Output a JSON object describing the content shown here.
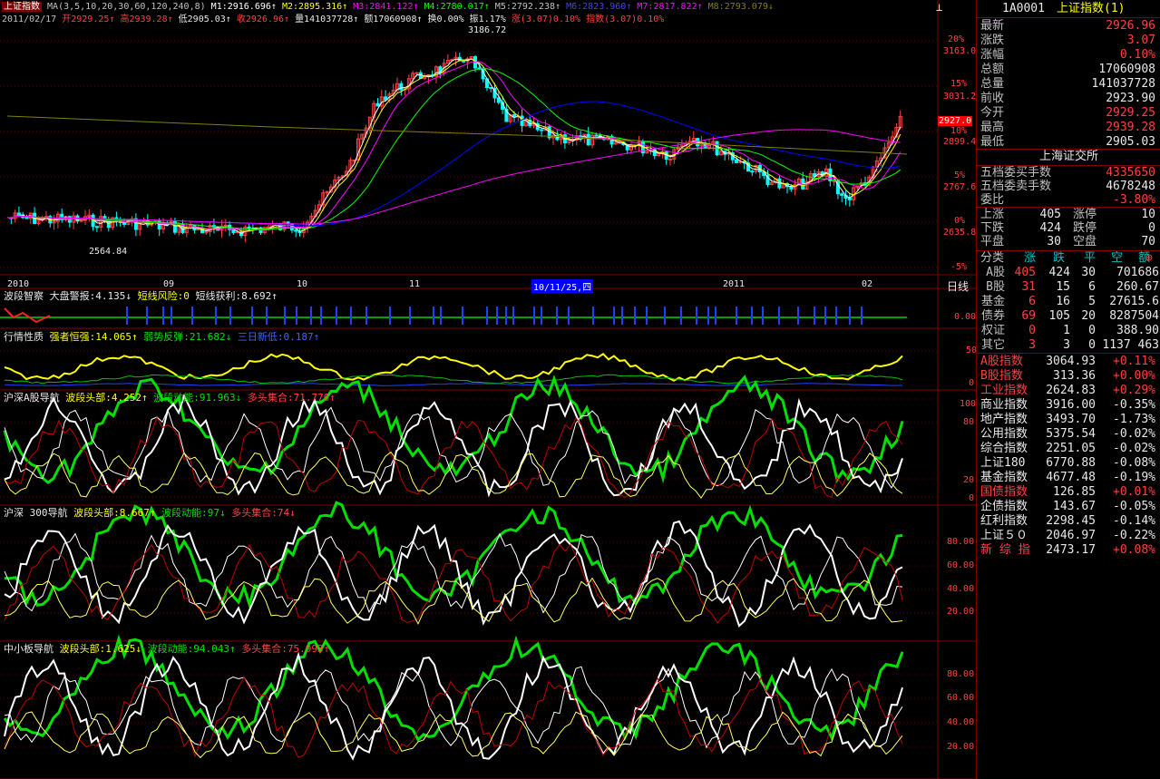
{
  "colors": {
    "up": "#ff4040",
    "down": "#00e000",
    "ma1": "#ffffff",
    "ma2": "#ffff00",
    "ma3": "#ff00ff",
    "ma4": "#00ff00",
    "ma5": "#c0c0c0",
    "ma6": "#0000ff",
    "ma7": "#ff00ff",
    "ma8": "#808000",
    "frame": "#800000"
  },
  "header": {
    "title": "上证指数",
    "ma_label": "MA(3,5,10,20,30,60,120,240,8)",
    "ma_values": [
      "M1:2916.696↑",
      "M2:2895.316↑",
      "M3:2841.122↑",
      "M4:2780.017↑",
      "M5:2792.238↑",
      "M6:2823.960↑",
      "M7:2817.822↑",
      "M8:2793.079↓"
    ],
    "line2": [
      "2011/02/17",
      "开2929.25↑",
      "高2939.28↑",
      "低2905.03↑",
      "收2926.96↑",
      "量141037728↑",
      "额17060908↑",
      "换0.00%",
      "振1.17%",
      "涨(3.07)0.10%",
      "指数(3.07)0.10%"
    ]
  },
  "price_axis": {
    "labels": [
      "3163.0",
      "3031.2",
      "2899.4",
      "2767.6",
      "2635.8"
    ],
    "pct": [
      "20%",
      "15%",
      "10%",
      "5%",
      "0%",
      "-5%"
    ],
    "current_tag": "2927.0",
    "high_label": "3186.72",
    "low_label": "2564.84"
  },
  "time_axis": {
    "labels": [
      "2010",
      "09",
      "10",
      "11",
      "10/11/25,四",
      "2011",
      "02"
    ],
    "period": "日线"
  },
  "indicators": [
    {
      "title": "波段智察",
      "items": [
        "大盘警报:4.135↓",
        "短线风险:0",
        "短线获利:8.692↑"
      ],
      "axis": [
        "0.00"
      ]
    },
    {
      "title": "行情性质",
      "items": [
        "强者恒强:14.065↑",
        "弱势反弹:21.682↓",
        "三日新低:0.187↑"
      ],
      "axis": [
        "50",
        "0"
      ]
    },
    {
      "title": "沪深A股导航",
      "items": [
        "波段头部:4.252↑",
        "波段动能:91.963↓",
        "多头集合:71.776↑"
      ],
      "axis": [
        "100",
        "80",
        "20",
        "0"
      ]
    },
    {
      "title": "沪深 300导航",
      "items": [
        "波段头部:8.667↑",
        "波段动能:97↓",
        "多头集合:74↓"
      ],
      "axis": [
        "80.00",
        "60.00",
        "40.00",
        "20.00"
      ]
    },
    {
      "title": "中小板导航",
      "items": [
        "波段头部:1.625↓",
        "波段动能:94.043↑",
        "多头集合:75.993↑"
      ],
      "axis": [
        "80.00",
        "60.00",
        "40.00",
        "20.00"
      ]
    }
  ],
  "panel": {
    "code": "1A0001",
    "name": "上证指数(1)",
    "quote": [
      {
        "label": "最新",
        "value": "2926.96",
        "c": "red"
      },
      {
        "label": "涨跌",
        "value": "3.07",
        "c": "red"
      },
      {
        "label": "涨幅",
        "value": "0.10%",
        "c": "red"
      },
      {
        "label": "总额",
        "value": "17060908",
        "c": "white"
      },
      {
        "label": "总量",
        "value": "141037728",
        "c": "white"
      },
      {
        "label": "前收",
        "value": "2923.90",
        "c": "white"
      },
      {
        "label": "今开",
        "value": "2929.25",
        "c": "red"
      },
      {
        "label": "最高",
        "value": "2939.28",
        "c": "red"
      },
      {
        "label": "最低",
        "value": "2905.03",
        "c": "white"
      }
    ],
    "exchange": "上海证交所",
    "orders": [
      {
        "label": "五档委买手数",
        "value": "4335650",
        "c": "red"
      },
      {
        "label": "五档委卖手数",
        "value": "4678248",
        "c": "white"
      },
      {
        "label": "委比",
        "value": "-3.80%",
        "c": "red"
      }
    ],
    "breadth": [
      {
        "l1": "上涨",
        "v1": "405",
        "l2": "涨停",
        "v2": "10"
      },
      {
        "l1": "下跌",
        "v1": "424",
        "l2": "跌停",
        "v2": "0"
      },
      {
        "l1": "平盘",
        "v1": "30",
        "l2": "空盘",
        "v2": "70"
      }
    ],
    "cls_header": [
      "分类",
      "涨",
      "跌",
      "平",
      "空",
      "额"
    ],
    "cls_rows": [
      {
        "n": "A股",
        "a": "405",
        "b": "424",
        "c": "30",
        "d": "701686"
      },
      {
        "n": "B股",
        "a": "31",
        "b": "15",
        "c": "6",
        "d": "260.67"
      },
      {
        "n": "基金",
        "a": "6",
        "b": "16",
        "c": "5",
        "d": "27615.6"
      },
      {
        "n": "债券",
        "a": "69",
        "b": "105",
        "c": "20",
        "d": "8287504"
      },
      {
        "n": "权证",
        "a": "0",
        "b": "1",
        "c": "0",
        "d": "388.90"
      },
      {
        "n": "其它",
        "a": "3",
        "b": "3",
        "c": "0",
        "d": "1137 463"
      }
    ],
    "indices": [
      {
        "n": "A股指数",
        "v": "3064.93",
        "p": "+0.11%",
        "c": "red"
      },
      {
        "n": "B股指数",
        "v": "313.36",
        "p": "+0.00%",
        "c": "red"
      },
      {
        "n": "工业指数",
        "v": "2624.83",
        "p": "+0.29%",
        "c": "red"
      },
      {
        "n": "商业指数",
        "v": "3916.00",
        "p": "-0.35%",
        "c": "white"
      },
      {
        "n": "地产指数",
        "v": "3493.70",
        "p": "-1.73%",
        "c": "white"
      },
      {
        "n": "公用指数",
        "v": "5375.54",
        "p": "-0.02%",
        "c": "white"
      },
      {
        "n": "综合指数",
        "v": "2251.05",
        "p": "-0.02%",
        "c": "white"
      },
      {
        "n": "上证180",
        "v": "6770.88",
        "p": "-0.08%",
        "c": "white"
      },
      {
        "n": "基金指数",
        "v": "4677.48",
        "p": "-0.19%",
        "c": "white"
      },
      {
        "n": "国债指数",
        "v": "126.85",
        "p": "+0.01%",
        "c": "red"
      },
      {
        "n": "企债指数",
        "v": "143.67",
        "p": "-0.05%",
        "c": "white"
      },
      {
        "n": "红利指数",
        "v": "2298.45",
        "p": "-0.14%",
        "c": "white"
      },
      {
        "n": "上证５０",
        "v": "2046.97",
        "p": "-0.22%",
        "c": "white"
      },
      {
        "n": "新 综 指",
        "v": "2473.17",
        "p": "+0.08%",
        "c": "red"
      }
    ]
  }
}
